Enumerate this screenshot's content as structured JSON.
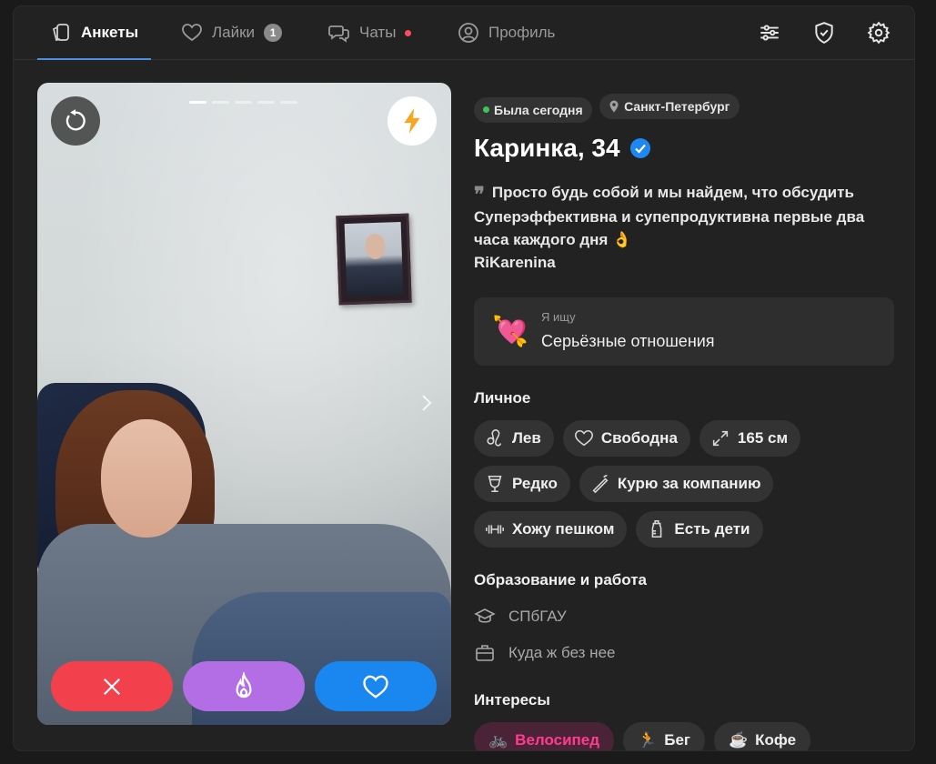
{
  "nav": {
    "tabs": [
      {
        "label": "Анкеты",
        "icon": "cards-icon"
      },
      {
        "label": "Лайки",
        "icon": "heart-icon",
        "badge": "1"
      },
      {
        "label": "Чаты",
        "icon": "chat-icon"
      },
      {
        "label": "Профиль",
        "icon": "profile-icon"
      }
    ],
    "right_icons": [
      "filters-icon",
      "shield-check-icon",
      "settings-icon"
    ]
  },
  "photo": {
    "slide_count": 5,
    "active_slide": 1
  },
  "profile": {
    "status": "Была сегодня",
    "city": "Санкт-Петербург",
    "name_age": "Каринка, 34",
    "bio_lines": [
      "Просто будь собой и мы найдем, что обсудить",
      "Суперэффективна и супепродуктивна первые два",
      "часа каждого дня 👌",
      "RiKarenina"
    ],
    "seeking": {
      "label": "Я ищу",
      "value": "Серьёзные отношения",
      "emoji": "💘"
    }
  },
  "personal": {
    "title": "Личное",
    "chips": [
      "Лев",
      "Свободна",
      "165 см",
      "Редко",
      "Курю за компанию",
      "Хожу пешком",
      "Есть дети"
    ]
  },
  "education": {
    "title": "Образование и работа",
    "items": [
      "СПбГАУ",
      "Куда ж без нее"
    ]
  },
  "interests": {
    "title": "Интересы",
    "chips": [
      "Велосипед",
      "Бег",
      "Кофе"
    ]
  },
  "colors": {
    "like": "#1a86f0",
    "dislike": "#f2404c",
    "superlike": "#b36ee6",
    "accent": "#4a90e2"
  }
}
